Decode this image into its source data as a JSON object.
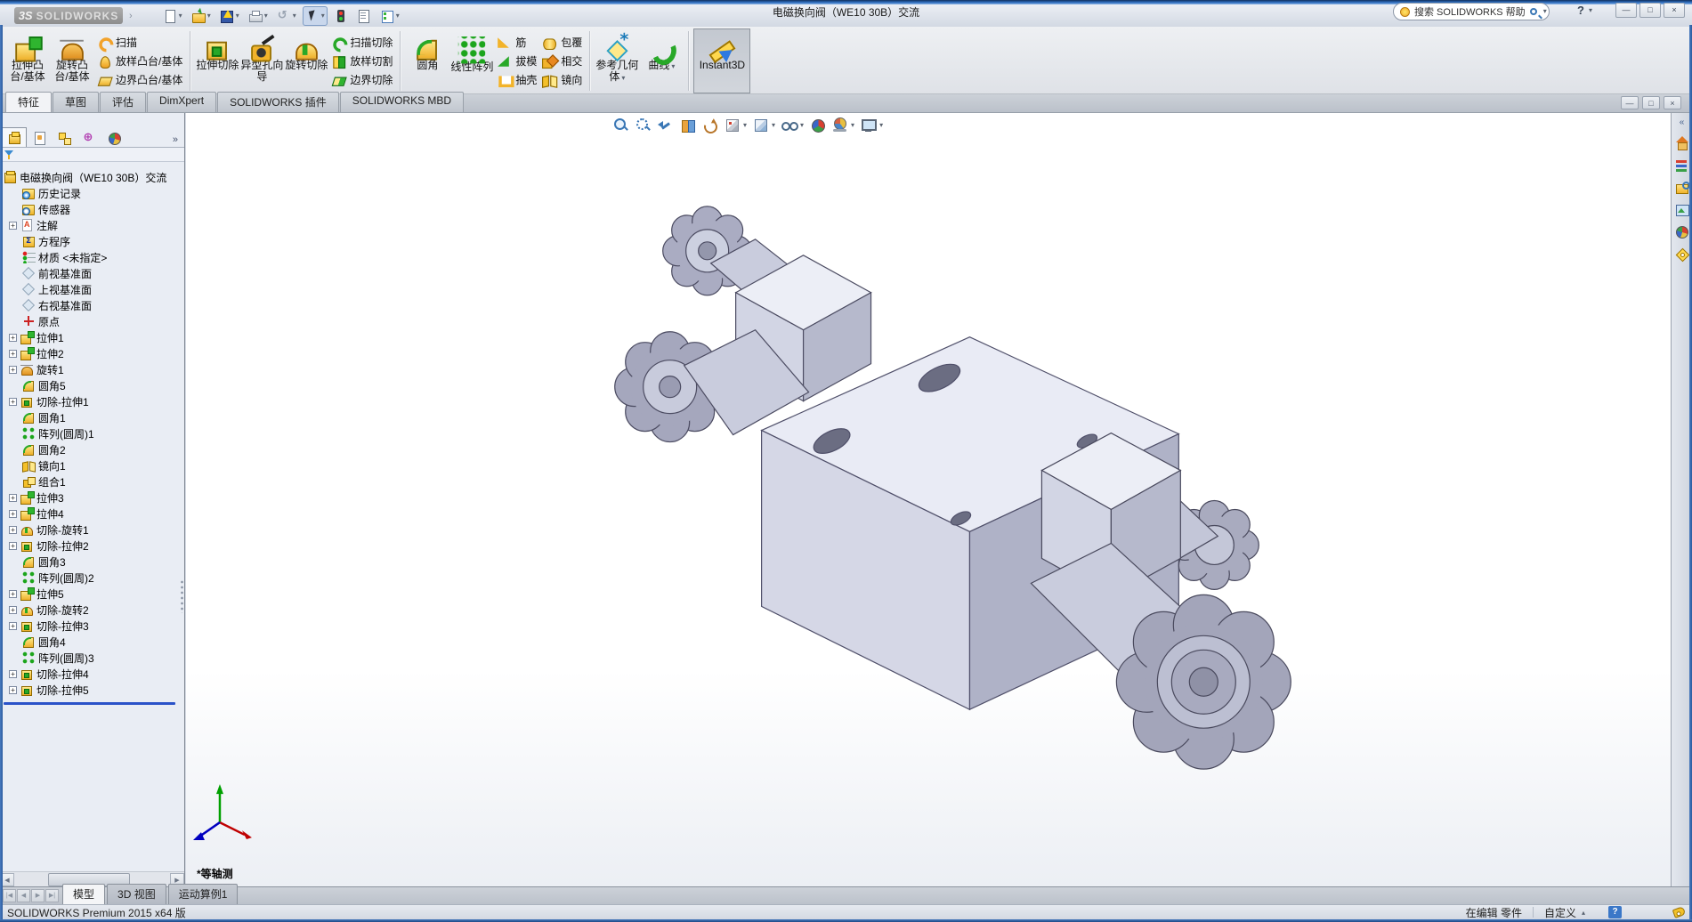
{
  "window": {
    "brand_prefix": "3S",
    "brand": "SOLIDWORKS",
    "title": "电磁换向阀（WE10 30B）交流",
    "controls": [
      {
        "name": "minimize",
        "glyph": "—"
      },
      {
        "name": "maximize",
        "glyph": "□"
      },
      {
        "name": "close",
        "glyph": "×"
      }
    ]
  },
  "ui": {
    "caret_down": "▾",
    "caret_up": "▴",
    "overflow_chevron": "»",
    "menu_expand": "›",
    "collapse_chevron": "«",
    "plus": "+",
    "help_glyph": "?"
  },
  "colors": {
    "titlebar_blue": "#2f6fc1",
    "sw_yellow": "#f2b32a",
    "sw_green": "#28a828",
    "rollback_blue": "#2a52c8",
    "panel_bg": "#e9edf4"
  },
  "quick_access": [
    {
      "name": "new-document",
      "dropdown": true
    },
    {
      "name": "open",
      "dropdown": true
    },
    {
      "name": "save",
      "dropdown": true
    },
    {
      "name": "print",
      "dropdown": true
    },
    {
      "name": "undo",
      "dropdown": true
    },
    {
      "name": "select",
      "dropdown": true,
      "pressed": true
    },
    {
      "name": "rebuild"
    },
    {
      "name": "file-properties"
    },
    {
      "name": "options",
      "dropdown": true
    }
  ],
  "search": {
    "placeholder": "搜索 SOLIDWORKS 帮助"
  },
  "ribbon": {
    "tabs": [
      {
        "id": "features",
        "label": "特征",
        "active": true
      },
      {
        "id": "sketch",
        "label": "草图"
      },
      {
        "id": "evaluate",
        "label": "评估"
      },
      {
        "id": "dimxpert",
        "label": "DimXpert"
      },
      {
        "id": "addins",
        "label": "SOLIDWORKS 插件"
      },
      {
        "id": "mbd",
        "label": "SOLIDWORKS MBD"
      }
    ],
    "groups": [
      {
        "big": [
          {
            "label": "拉伸凸台/基体",
            "icon": "extrude-boss"
          },
          {
            "label": "旋转凸台/基体",
            "icon": "revolve-boss"
          }
        ],
        "small": [
          {
            "label": "扫描",
            "icon": "sweep"
          },
          {
            "label": "放样凸台/基体",
            "icon": "loft"
          },
          {
            "label": "边界凸台/基体",
            "icon": "boundary"
          }
        ]
      },
      {
        "big": [
          {
            "label": "拉伸切除",
            "icon": "extrude-cut"
          },
          {
            "label": "异型孔向导",
            "icon": "hole-wizard"
          },
          {
            "label": "旋转切除",
            "icon": "revolve-cut"
          }
        ],
        "small": [
          {
            "label": "扫描切除",
            "icon": "sweep-cut"
          },
          {
            "label": "放样切割",
            "icon": "loft-cut"
          },
          {
            "label": "边界切除",
            "icon": "boundary-cut"
          }
        ]
      },
      {
        "big": [
          {
            "label": "圆角",
            "icon": "fillet"
          },
          {
            "label": "线性阵列",
            "icon": "linear-pattern"
          }
        ],
        "small": [
          {
            "label": "筋",
            "icon": "rib"
          },
          {
            "label": "拔模",
            "icon": "draft"
          },
          {
            "label": "抽壳",
            "icon": "shell"
          }
        ],
        "small2": [
          {
            "label": "包覆",
            "icon": "wrap"
          },
          {
            "label": "相交",
            "icon": "intersect"
          },
          {
            "label": "镜向",
            "icon": "mirror"
          }
        ]
      },
      {
        "big": [
          {
            "label": "参考几何体",
            "icon": "ref-geometry",
            "dropdown": true
          },
          {
            "label": "曲线",
            "icon": "curves",
            "dropdown": true
          }
        ]
      },
      {
        "big": [
          {
            "label": "Instant3D",
            "icon": "instant3d",
            "active": true
          }
        ]
      }
    ]
  },
  "mdi_controls": [
    {
      "name": "minimize-document",
      "glyph": "—"
    },
    {
      "name": "restore-document",
      "glyph": "□"
    },
    {
      "name": "close-document",
      "glyph": "×"
    }
  ],
  "headsup": [
    {
      "name": "zoom-to-fit"
    },
    {
      "name": "zoom-to-area"
    },
    {
      "name": "previous-view"
    },
    {
      "name": "section-view"
    },
    {
      "name": "view-rotate"
    },
    {
      "name": "view-orientation",
      "dropdown": true
    },
    {
      "name": "display-style",
      "dropdown": true
    },
    {
      "name": "hide-show-items",
      "dropdown": true
    },
    {
      "name": "edit-appearance"
    },
    {
      "name": "apply-scene",
      "dropdown": true
    },
    {
      "name": "view-settings",
      "dropdown": true
    }
  ],
  "panel_tabs": [
    {
      "name": "featuremanager",
      "active": true
    },
    {
      "name": "propertymanager"
    },
    {
      "name": "configurationmanager"
    },
    {
      "name": "dimxpertmanager"
    },
    {
      "name": "displaymanager"
    }
  ],
  "feature_tree": {
    "root": {
      "label": "电磁换向阀（WE10 30B）交流",
      "icon": "part"
    },
    "items": [
      {
        "label": "历史记录",
        "icon": "history"
      },
      {
        "label": "传感器",
        "icon": "sensor"
      },
      {
        "label": "注解",
        "icon": "annotations",
        "plus": true
      },
      {
        "label": "方程序",
        "icon": "equations"
      },
      {
        "label": "材质 <未指定>",
        "icon": "material"
      },
      {
        "label": "前视基准面",
        "icon": "plane"
      },
      {
        "label": "上视基准面",
        "icon": "plane"
      },
      {
        "label": "右视基准面",
        "icon": "plane"
      },
      {
        "label": "原点",
        "icon": "origin"
      },
      {
        "label": "拉伸1",
        "icon": "extrude-boss",
        "plus": true
      },
      {
        "label": "拉伸2",
        "icon": "extrude-boss",
        "plus": true
      },
      {
        "label": "旋转1",
        "icon": "revolve-boss",
        "plus": true
      },
      {
        "label": "圆角5",
        "icon": "fillet"
      },
      {
        "label": "切除-拉伸1",
        "icon": "extrude-cut",
        "plus": true
      },
      {
        "label": "圆角1",
        "icon": "fillet"
      },
      {
        "label": "阵列(圆周)1",
        "icon": "pattern-circular"
      },
      {
        "label": "圆角2",
        "icon": "fillet"
      },
      {
        "label": "镜向1",
        "icon": "mirror"
      },
      {
        "label": "组合1",
        "icon": "combine"
      },
      {
        "label": "拉伸3",
        "icon": "extrude-boss",
        "plus": true
      },
      {
        "label": "拉伸4",
        "icon": "extrude-boss",
        "plus": true
      },
      {
        "label": "切除-旋转1",
        "icon": "revolve-cut",
        "plus": true
      },
      {
        "label": "切除-拉伸2",
        "icon": "extrude-cut",
        "plus": true
      },
      {
        "label": "圆角3",
        "icon": "fillet"
      },
      {
        "label": "阵列(圆周)2",
        "icon": "pattern-circular"
      },
      {
        "label": "拉伸5",
        "icon": "extrude-boss",
        "plus": true
      },
      {
        "label": "切除-旋转2",
        "icon": "revolve-cut",
        "plus": true
      },
      {
        "label": "切除-拉伸3",
        "icon": "extrude-cut",
        "plus": true
      },
      {
        "label": "圆角4",
        "icon": "fillet"
      },
      {
        "label": "阵列(圆周)3",
        "icon": "pattern-circular"
      },
      {
        "label": "切除-拉伸4",
        "icon": "extrude-cut",
        "plus": true
      },
      {
        "label": "切除-拉伸5",
        "icon": "extrude-cut",
        "plus": true
      }
    ]
  },
  "viewport": {
    "view_label": "*等轴测"
  },
  "task_pane": [
    {
      "name": "resources"
    },
    {
      "name": "design-library"
    },
    {
      "name": "file-explorer"
    },
    {
      "name": "view-palette"
    },
    {
      "name": "appearances"
    },
    {
      "name": "custom-properties"
    }
  ],
  "bottom_bar": {
    "nav": [
      {
        "name": "first-tab",
        "glyph": "|◀"
      },
      {
        "name": "previous-tab",
        "glyph": "◀"
      },
      {
        "name": "next-tab",
        "glyph": "▶"
      },
      {
        "name": "last-tab",
        "glyph": "▶|"
      }
    ],
    "tabs": [
      {
        "label": "模型",
        "active": true
      },
      {
        "label": "3D 视图"
      },
      {
        "label": "运动算例1"
      }
    ]
  },
  "status_bar": {
    "product": "SOLIDWORKS Premium 2015 x64 版",
    "editing": "在编辑 零件",
    "units": "自定义"
  }
}
